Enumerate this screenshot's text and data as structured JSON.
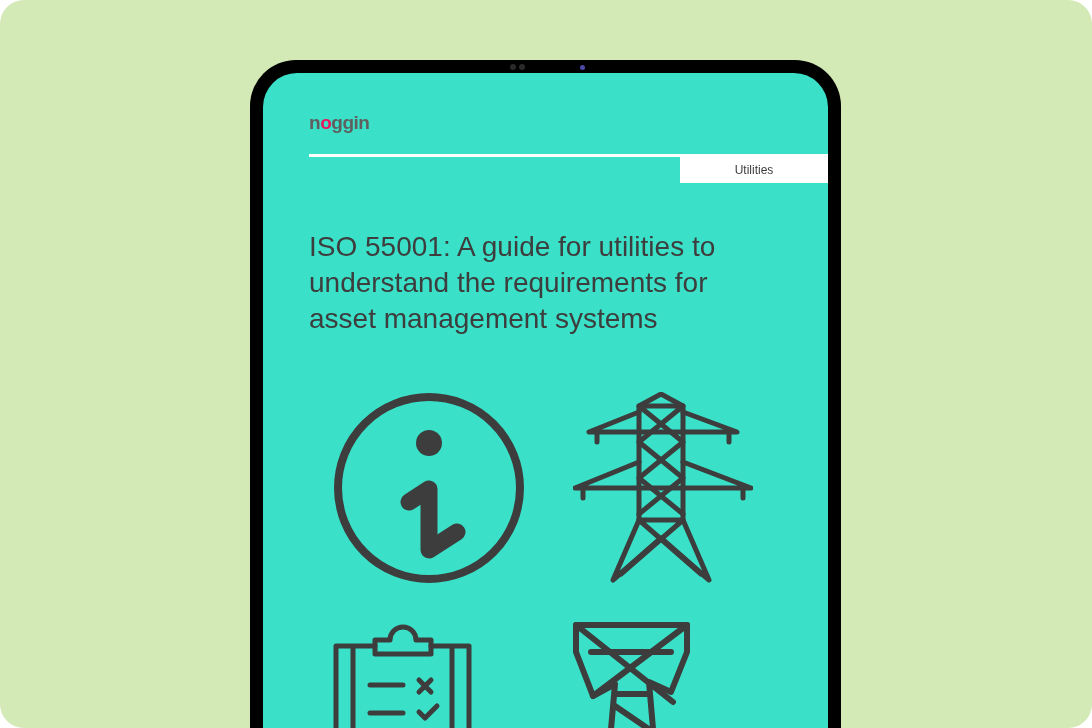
{
  "logo": {
    "parts": [
      {
        "text": "n",
        "accent": false
      },
      {
        "text": "o",
        "accent": true
      },
      {
        "text": "ggin",
        "accent": false
      }
    ]
  },
  "category_tab": {
    "label": "Utilities"
  },
  "title": "ISO 55001: A guide for utilities to understand the requirements for asset management systems"
}
